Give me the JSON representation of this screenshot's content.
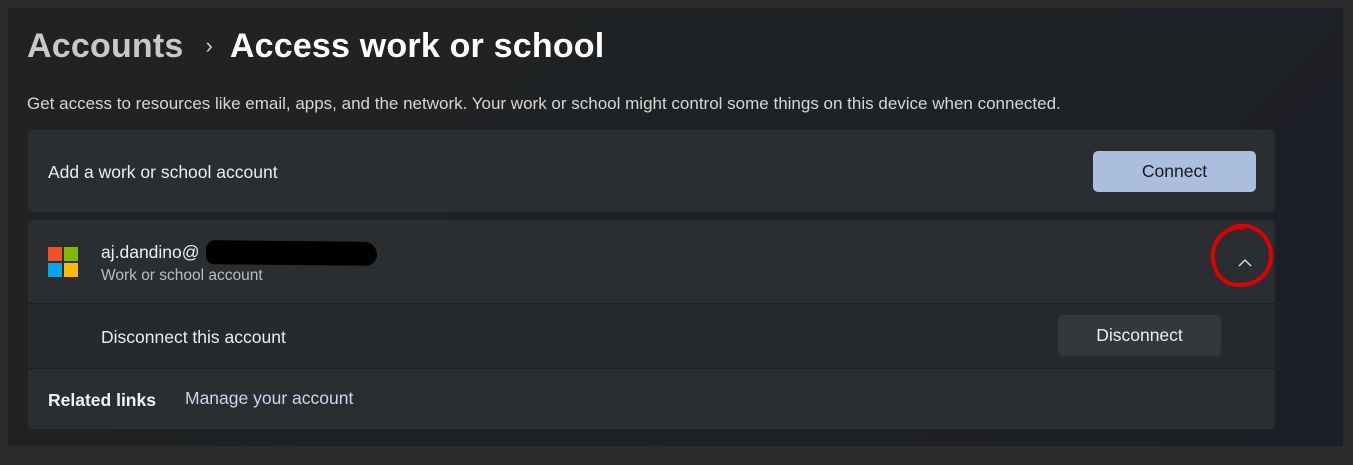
{
  "breadcrumb": {
    "parent": "Accounts",
    "separator": "›",
    "current": "Access work or school"
  },
  "description": "Get access to resources like email, apps, and the network. Your work or school might control some things on this device when connected.",
  "add_account": {
    "label": "Add a work or school account",
    "button_label": "Connect"
  },
  "account": {
    "email_visible": "aj.dandino@",
    "type": "Work or school account",
    "expander_icon": "chevron-up-icon",
    "logo_colors": [
      "#f25022",
      "#7fba00",
      "#00a4ef",
      "#ffb900"
    ]
  },
  "disconnect": {
    "label": "Disconnect this account",
    "button_label": "Disconnect"
  },
  "related_links": {
    "title": "Related links",
    "links": [
      "Manage your account"
    ]
  },
  "colors": {
    "accent_button": "#acbedd",
    "annotation": "#e00000"
  }
}
